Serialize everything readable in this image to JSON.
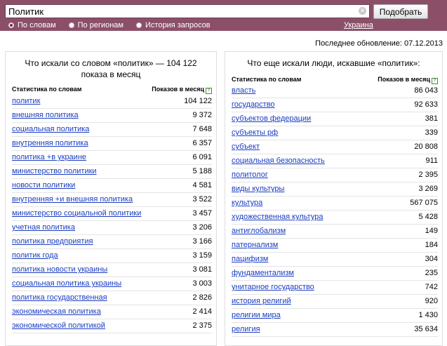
{
  "search": {
    "query": "Политик",
    "submit_label": "Подобрать"
  },
  "modes": [
    {
      "label": "По словам",
      "checked": true
    },
    {
      "label": "По регионам",
      "checked": false
    },
    {
      "label": "История запросов",
      "checked": false
    }
  ],
  "region": "Украина",
  "last_update": "Последнее обновление: 07.12.2013",
  "left_panel": {
    "title": "Что искали со словом «политик» — 104 122 показа в месяц",
    "col_word": "Статистика по словам",
    "col_count": "Показов в месяц",
    "rows": [
      {
        "word": "политик",
        "count": "104 122"
      },
      {
        "word": "внешняя политика",
        "count": "9 372"
      },
      {
        "word": "социальная политика",
        "count": "7 648"
      },
      {
        "word": "внутренняя политика",
        "count": "6 357"
      },
      {
        "word": "политика +в украине",
        "count": "6 091"
      },
      {
        "word": "министерство политики",
        "count": "5 188"
      },
      {
        "word": "новости политики",
        "count": "4 581"
      },
      {
        "word": "внутренняя +и внешняя политика",
        "count": "3 522"
      },
      {
        "word": "министерство социальной политики",
        "count": "3 457"
      },
      {
        "word": "учетная политика",
        "count": "3 206"
      },
      {
        "word": "политика предприятия",
        "count": "3 166"
      },
      {
        "word": "политик года",
        "count": "3 159"
      },
      {
        "word": "политика новости украины",
        "count": "3 081"
      },
      {
        "word": "социальная политика украины",
        "count": "3 003"
      },
      {
        "word": "политика государственная",
        "count": "2 826"
      },
      {
        "word": "экономическая политика",
        "count": "2 414"
      },
      {
        "word": "экономической политикой",
        "count": "2 375"
      }
    ]
  },
  "right_panel": {
    "title": "Что еще искали люди, искавшие «политик»:",
    "col_word": "Статистика по словам",
    "col_count": "Показов в месяц",
    "rows": [
      {
        "word": "власть",
        "count": "86 043"
      },
      {
        "word": "государство",
        "count": "92 633"
      },
      {
        "word": "субъектов федерации",
        "count": "381"
      },
      {
        "word": "субъекты рф",
        "count": "339"
      },
      {
        "word": "субъект",
        "count": "20 808"
      },
      {
        "word": "социальная безопасность",
        "count": "911"
      },
      {
        "word": "политолог",
        "count": "2 395"
      },
      {
        "word": "виды культуры",
        "count": "3 269"
      },
      {
        "word": "культура",
        "count": "567 075"
      },
      {
        "word": "художественная культура",
        "count": "5 428"
      },
      {
        "word": "антиглобализм",
        "count": "149"
      },
      {
        "word": "патернализм",
        "count": "184"
      },
      {
        "word": "пацифизм",
        "count": "304"
      },
      {
        "word": "фундаментализм",
        "count": "235"
      },
      {
        "word": "унитарное государство",
        "count": "742"
      },
      {
        "word": "история религий",
        "count": "920"
      },
      {
        "word": "религии мира",
        "count": "1 430"
      },
      {
        "word": "религия",
        "count": "35 634"
      }
    ]
  }
}
